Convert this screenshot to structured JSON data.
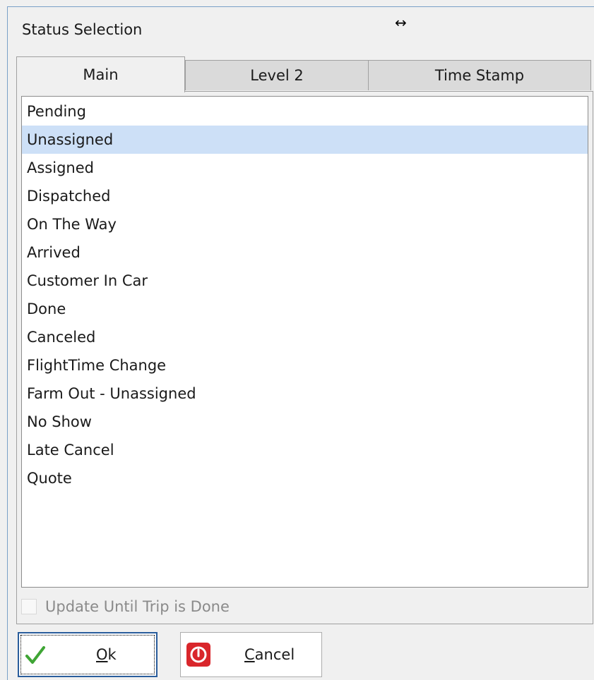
{
  "window": {
    "title": "Status Selection",
    "resize_icon": "left-right-arrow-icon"
  },
  "tabs": [
    {
      "label": "Main",
      "active": true
    },
    {
      "label": "Level 2",
      "active": false
    },
    {
      "label": "Time Stamp",
      "active": false
    }
  ],
  "status_list": {
    "selected": "Unassigned",
    "items": [
      "Pending",
      "Unassigned",
      "Assigned",
      "Dispatched",
      "On The Way",
      "Arrived",
      "Customer In Car",
      "Done",
      "Canceled",
      "FlightTime Change",
      "Farm Out - Unassigned",
      "No Show",
      "Late Cancel",
      "Quote"
    ]
  },
  "update_checkbox": {
    "label": "Update Until Trip is Done",
    "checked": false,
    "enabled": false
  },
  "buttons": {
    "ok": {
      "mnemonic": "O",
      "rest": "k",
      "icon": "checkmark-icon"
    },
    "cancel": {
      "mnemonic": "C",
      "rest": "ancel",
      "icon": "power-icon"
    }
  },
  "colors": {
    "selection": "#cde0f7",
    "ok_check": "#3fa535",
    "cancel_icon": "#d9262b"
  }
}
